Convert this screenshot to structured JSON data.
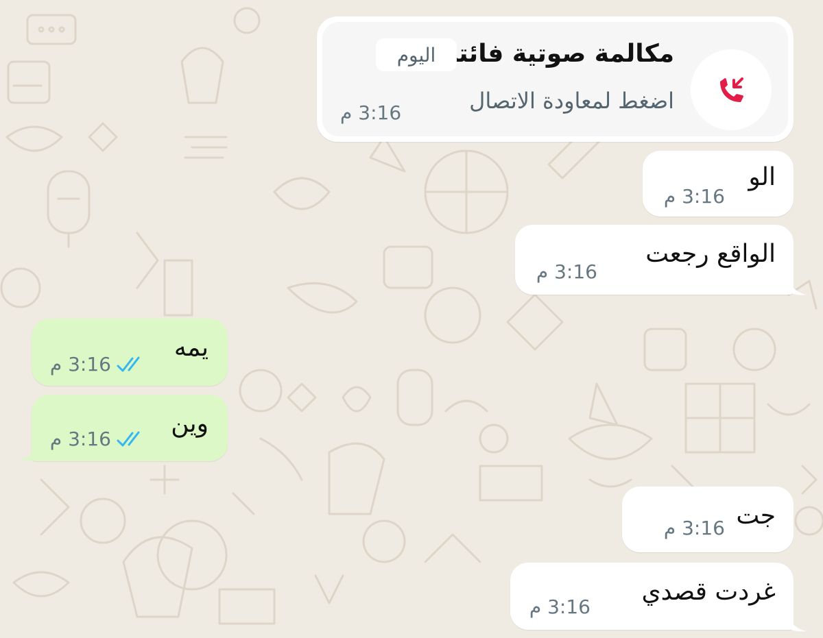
{
  "missed_call": {
    "title": "مكالمة صوتية فائتة",
    "day_chip": "اليوم",
    "subtitle": "اضغط لمعاودة الاتصال",
    "time": "3:16 م",
    "icon": "missed-call-icon",
    "icon_color": "#e11d48"
  },
  "messages": [
    {
      "text": "الو",
      "time": "3:16 م",
      "direction": "incoming"
    },
    {
      "text": "الواقع رجعت",
      "time": "3:16 م",
      "direction": "incoming"
    },
    {
      "text": "يمه",
      "time": "3:16 م",
      "direction": "outgoing",
      "status": "read"
    },
    {
      "text": "وين",
      "time": "3:16 م",
      "direction": "outgoing",
      "status": "read"
    },
    {
      "text": "جت",
      "time": "3:16 م",
      "direction": "incoming"
    },
    {
      "text": "غردت قصدي",
      "time": "3:16 م",
      "direction": "incoming"
    }
  ],
  "colors": {
    "background": "#efeae2",
    "incoming_bubble": "#ffffff",
    "outgoing_bubble": "#dcf8c6",
    "read_ticks": "#34b7f1"
  }
}
